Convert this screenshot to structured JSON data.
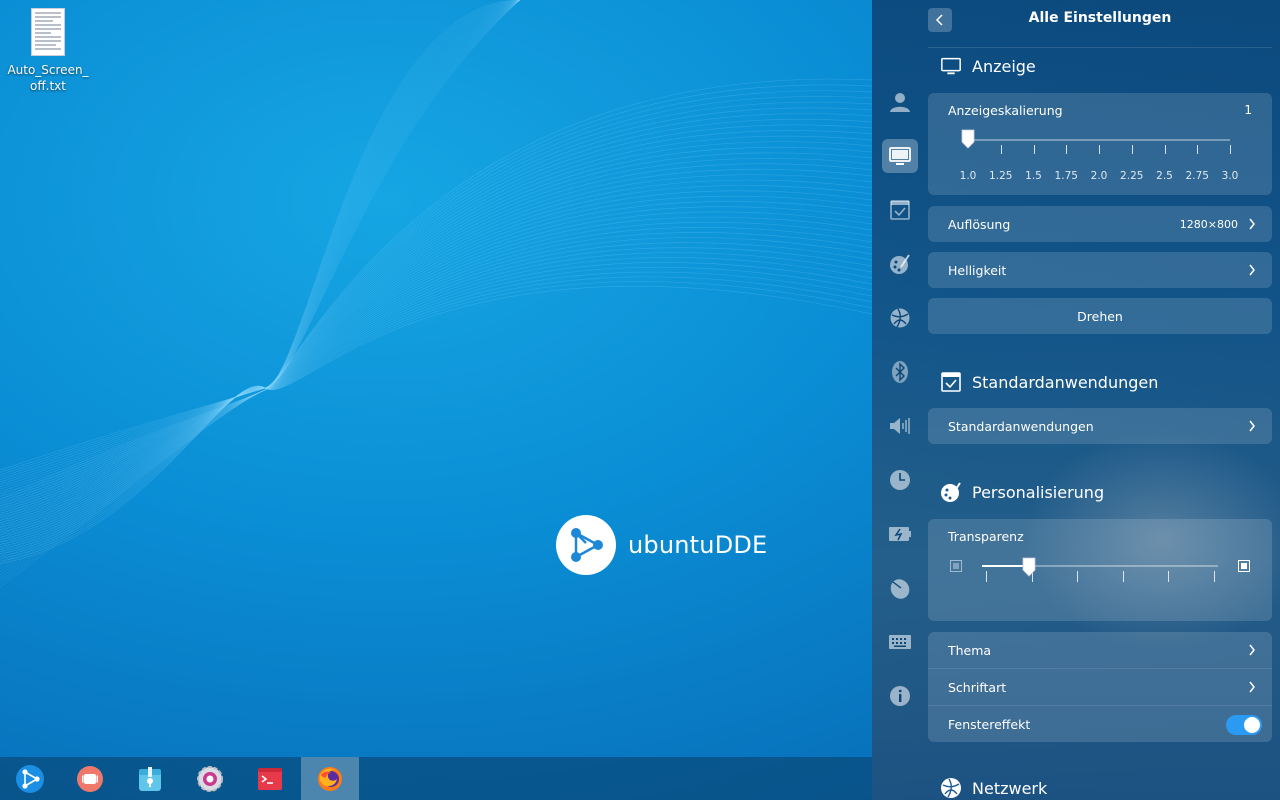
{
  "desktop": {
    "file": {
      "name": "Auto_Screen_off.txt"
    },
    "logo_text": "ubuntuDDE"
  },
  "dock": {
    "items": [
      {
        "icon": "launcher-icon",
        "active": false
      },
      {
        "icon": "multitasking-icon",
        "active": false
      },
      {
        "icon": "file-manager-icon",
        "active": false
      },
      {
        "icon": "control-center-icon",
        "active": false
      },
      {
        "icon": "terminal-icon",
        "active": false
      },
      {
        "icon": "firefox-icon",
        "active": true
      }
    ]
  },
  "control_center": {
    "title": "Alle Einstellungen",
    "nav_icons": [
      "accounts-icon",
      "display-icon",
      "default-apps-icon",
      "personalization-icon",
      "network-icon",
      "bluetooth-icon",
      "sound-icon",
      "datetime-icon",
      "power-icon",
      "mouse-icon",
      "keyboard-icon",
      "info-icon"
    ],
    "sections": {
      "display": {
        "title": "Anzeige",
        "scaling": {
          "label": "Anzeigeskalierung",
          "value": "1",
          "ticks": [
            "1.0",
            "1.25",
            "1.5",
            "1.75",
            "2.0",
            "2.25",
            "2.5",
            "2.75",
            "3.0"
          ],
          "selected_index": 0
        },
        "resolution": {
          "label": "Auflösung",
          "value": "1280×800"
        },
        "brightness": {
          "label": "Helligkeit"
        },
        "rotate": {
          "label": "Drehen"
        }
      },
      "default_apps": {
        "title": "Standardanwendungen",
        "item": {
          "label": "Standardanwendungen"
        }
      },
      "personalization": {
        "title": "Personalisierung",
        "transparency": {
          "label": "Transparenz",
          "level": 0.2,
          "tick_count": 6
        },
        "theme": {
          "label": "Thema"
        },
        "font": {
          "label": "Schriftart"
        },
        "window_effect": {
          "label": "Fenstereffekt",
          "enabled": true
        }
      },
      "network": {
        "title": "Netzwerk"
      }
    }
  },
  "colors": {
    "accent": "#2b9af3",
    "panel": "#0c4678"
  }
}
